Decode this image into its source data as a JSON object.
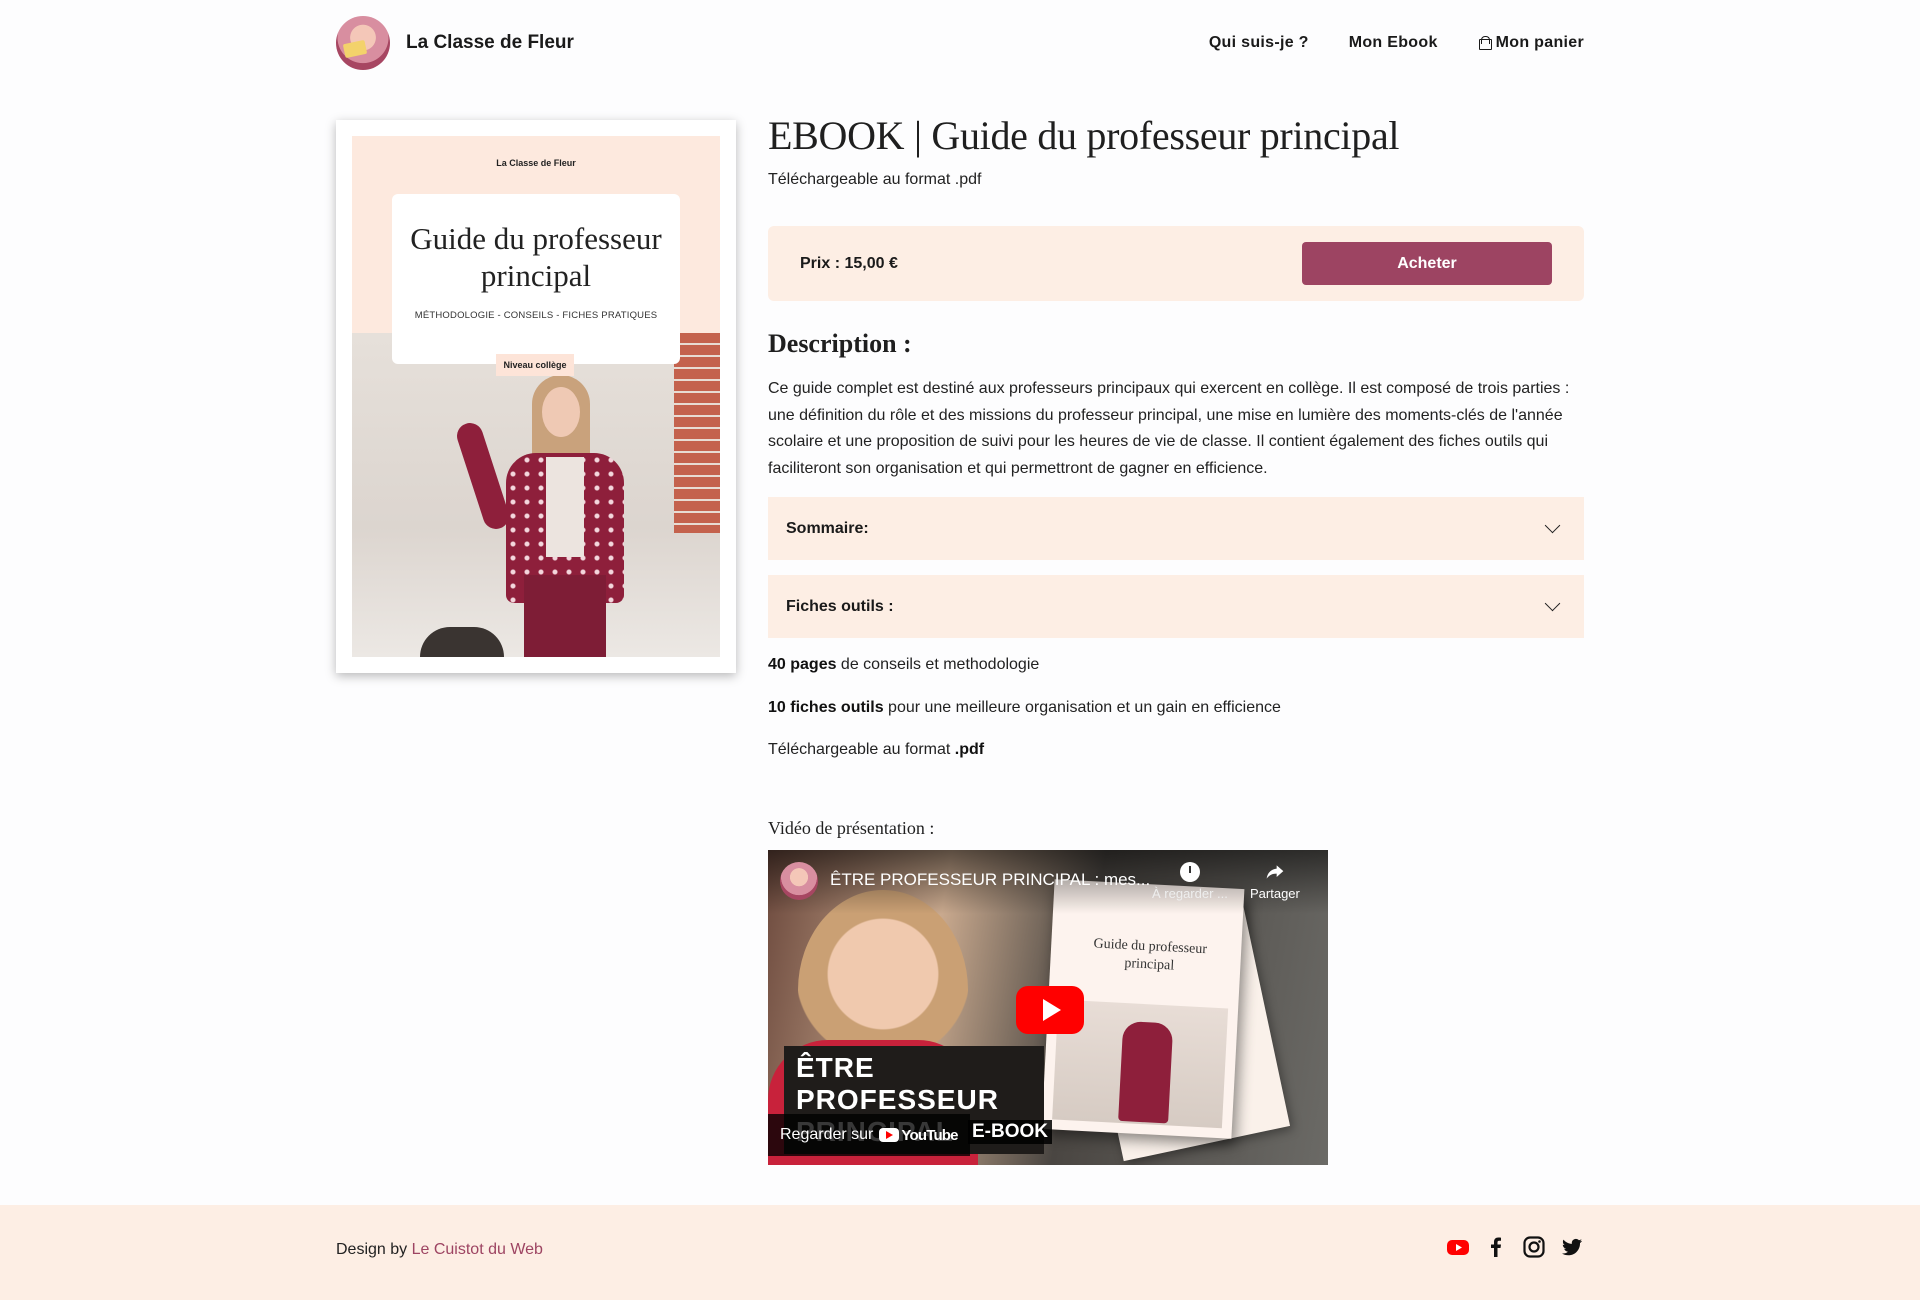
{
  "header": {
    "brand_name": "La Classe de Fleur",
    "nav": [
      {
        "label": "Qui suis-je ?"
      },
      {
        "label": "Mon Ebook"
      },
      {
        "label": "Mon panier",
        "icon": "bag-icon"
      }
    ]
  },
  "cover": {
    "brand": "La Classe de Fleur",
    "title": "Guide du professeur principal",
    "subtitle": "MÉTHODOLOGIE - CONSEILS - FICHES PRATIQUES",
    "level": "Niveau collège"
  },
  "product": {
    "title": "EBOOK | Guide du professeur principal",
    "format": "Téléchargeable au format .pdf",
    "price": "Prix : 15,00 €",
    "buy_label": "Acheter",
    "description_heading": "Description :",
    "description": "Ce guide complet est destiné aux professeurs principaux qui exercent en collège. Il est composé de trois parties : une définition du rôle et des missions du professeur principal, une mise en lumière des moments-clés de l'année scolaire et une proposition de suivi pour les heures de vie de classe. Il contient également des fiches outils qui faciliteront son organisation et qui permettront de gagner en efficience.",
    "accordions": [
      {
        "label": "Sommaire:"
      },
      {
        "label": "Fiches outils :"
      }
    ],
    "features": [
      {
        "strong": "40 pages",
        "text": " de conseils et methodologie"
      },
      {
        "strong": "10 fiches outils",
        "text": " pour une meilleure organisation et un gain en efficience"
      },
      {
        "text": "Téléchargeable au format ",
        "strong": ".pdf"
      }
    ],
    "video_label": "Vidéo de présentation :"
  },
  "video": {
    "title": "ÊTRE PROFESSEUR PRINCIPAL : mes...",
    "watch_later": "À regarder ...",
    "share": "Partager",
    "overlay": "ÊTRE PROFESSEUR PRINCIPAL",
    "ebook_tag": "E-BOOK",
    "watch_on": "Regarder sur",
    "youtube": "YouTube",
    "book_title": "Guide du professeur principal"
  },
  "footer": {
    "credit_prefix": "Design by",
    "credit_link": "Le Cuistot du Web",
    "socials": [
      "youtube-icon",
      "facebook-icon",
      "instagram-icon",
      "twitter-icon"
    ]
  },
  "colors": {
    "accent": "#9d4462",
    "peach": "#fdeee4"
  }
}
